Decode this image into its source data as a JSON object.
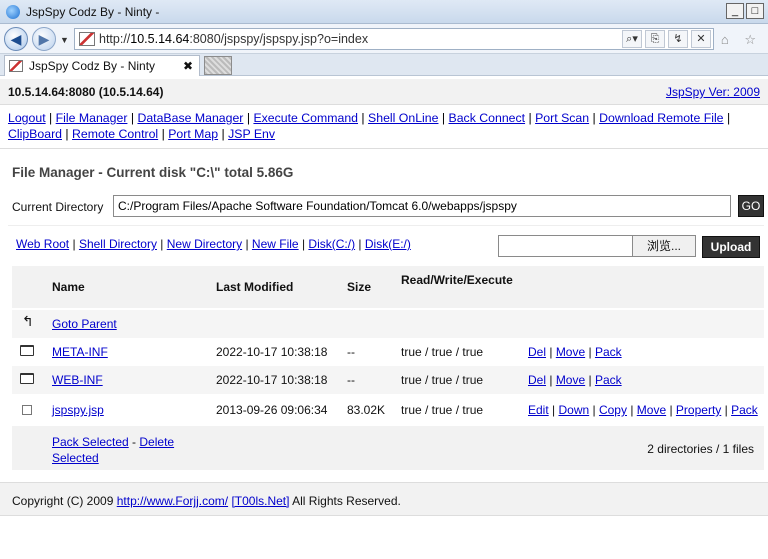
{
  "window": {
    "title": "JspSpy Codz By - Ninty -",
    "controls": [
      "_",
      "□"
    ]
  },
  "browser": {
    "url_prefix": "http://",
    "url_host": "10.5.14.64",
    "url_rest": ":8080/jspspy/jspspy.jsp?o=index",
    "tab_title": "JspSpy Codz By - Ninty",
    "tab_close": "✖",
    "nav_back": "◀",
    "nav_forward": "▶",
    "toolbar_icons": [
      "⌕▾",
      "⎘",
      "↯",
      "✕"
    ],
    "right_icons": "⌂ ☆"
  },
  "header": {
    "host": "10.5.14.64:8080 (10.5.14.64)",
    "version": "JspSpy Ver: 2009"
  },
  "menu": [
    "Logout",
    "File Manager",
    "DataBase Manager",
    "Execute Command",
    "Shell OnLine",
    "Back Connect",
    "Port Scan",
    "Download Remote File",
    "ClipBoard",
    "Remote Control",
    "Port Map",
    "JSP Env"
  ],
  "file_manager": {
    "title": "File Manager - Current disk \"C:\\\" total 5.86G",
    "current_dir_label": "Current Directory",
    "current_dir": "C:/Program Files/Apache Software Foundation/Tomcat 6.0/webapps/jspspy",
    "go_label": "GO",
    "tool_links": [
      "Web Root",
      "Shell Directory",
      "New Directory",
      "New File",
      "Disk(C:/)",
      "Disk(E:/)"
    ],
    "browse_label": "浏览...",
    "upload_label": "Upload",
    "columns": {
      "name": "Name",
      "modified": "Last Modified",
      "size": "Size",
      "rwe": "Read/Write/Execute"
    },
    "parent_label": "Goto Parent",
    "rows": [
      {
        "icon": "folder-icon",
        "name": "META-INF",
        "modified": "2022-10-17 10:38:18",
        "size": "--",
        "rwe": "true / true / true",
        "actions": [
          "Del",
          "Move",
          "Pack"
        ]
      },
      {
        "icon": "folder-icon",
        "name": "WEB-INF",
        "modified": "2022-10-17 10:38:18",
        "size": "--",
        "rwe": "true / true / true",
        "actions": [
          "Del",
          "Move",
          "Pack"
        ]
      },
      {
        "icon": "checkbox",
        "name": "jspspy.jsp",
        "modified": "2013-09-26 09:06:34",
        "size": "83.02K",
        "rwe": "true / true / true",
        "actions": [
          "Edit",
          "Down",
          "Copy",
          "Move",
          "Property",
          "Pack"
        ]
      }
    ],
    "pack_selected": "Pack Selected",
    "delete_selected": "Delete Selected",
    "counts": "2 directories / 1 files"
  },
  "footer": {
    "copyright": "Copyright (C) 2009",
    "link1": "http://www.Forjj.com/",
    "link2": "[T00ls.Net]",
    "suffix": "All Rights Reserved."
  }
}
